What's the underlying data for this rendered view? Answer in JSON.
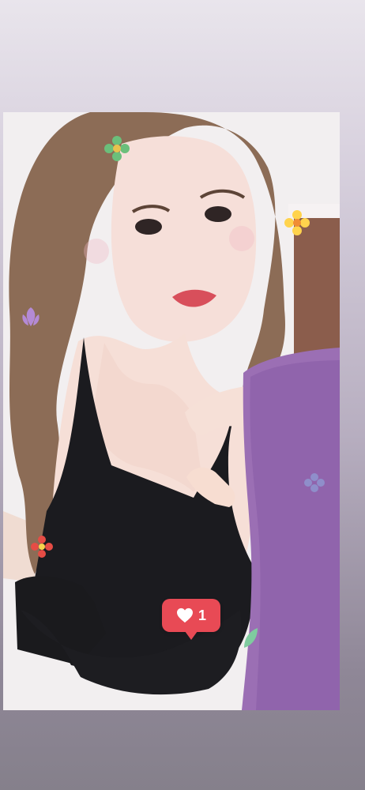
{
  "story": {
    "photo_icon": "selfie-photo",
    "like_sticker": {
      "icon": "heart-icon",
      "count": "1",
      "color": "#e84a55"
    },
    "stickers": [
      "green-flower-icon",
      "yellow-flower-icon",
      "purple-leaf-icon",
      "red-flower-icon",
      "blue-flower-icon",
      "green-leaf-icon"
    ],
    "bottom_text": ""
  }
}
